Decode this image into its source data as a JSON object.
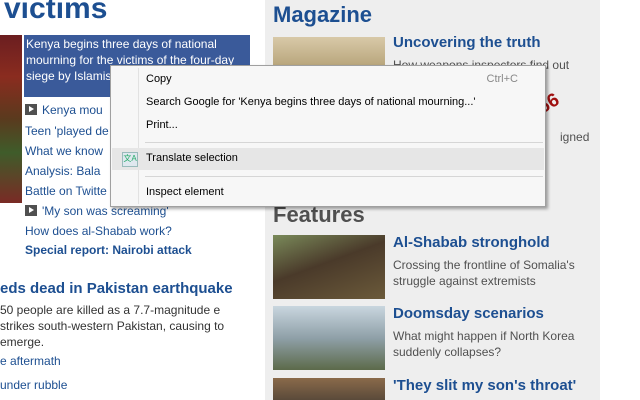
{
  "left": {
    "heading": "victims",
    "highlight_text": "Kenya begins three days of national mourning for the victims of the four-day siege by Islamist shopping centre",
    "links": [
      {
        "label": "Kenya mou",
        "video": true
      },
      {
        "label": "Teen 'played de",
        "video": false
      },
      {
        "label": "What we know",
        "video": false
      },
      {
        "label": "Analysis: Bala",
        "video": false
      },
      {
        "label": "Battle on Twitte",
        "video": false
      },
      {
        "label": "'My son was screaming'",
        "video": true
      },
      {
        "label": "How does al-Shabab work?",
        "video": false
      },
      {
        "label": "Special report: Nairobi attack",
        "video": false,
        "bold": true
      }
    ],
    "story2": {
      "headline": "eds dead in Pakistan earthquake",
      "summary": "50 people are killed as a 7.7-magnitude e strikes south-western Pakistan, causing to emerge.",
      "links": [
        "e aftermath",
        "under rubble"
      ]
    }
  },
  "magazine": {
    "title": "Magazine",
    "items": [
      {
        "headline": "Uncovering the truth",
        "summary": "How weapons inspectors find out"
      },
      {
        "headline": "",
        "summary": "igned"
      }
    ]
  },
  "features": {
    "title": "Features",
    "items": [
      {
        "headline": "Al-Shabab stronghold",
        "summary": "Crossing the frontline of Somalia's struggle against extremists"
      },
      {
        "headline": "Doomsday scenarios",
        "summary": "What might happen if North Korea suddenly collapses?"
      },
      {
        "headline": "'They slit my son's throat'",
        "summary": ""
      }
    ]
  },
  "context_menu": {
    "items": [
      {
        "label": "Copy",
        "shortcut": "Ctrl+C"
      },
      {
        "label": "Search Google for 'Kenya begins three days of national mourning...'",
        "shortcut": ""
      },
      {
        "label": "Print...",
        "shortcut": ""
      },
      {
        "label": "Translate selection",
        "shortcut": ""
      },
      {
        "label": "Inspect element",
        "shortcut": ""
      }
    ]
  },
  "watermark": "数创社scs66",
  "colors": {
    "link": "#1d4f91",
    "highlight": "#3a5a9a",
    "watermark": "#a01010"
  }
}
